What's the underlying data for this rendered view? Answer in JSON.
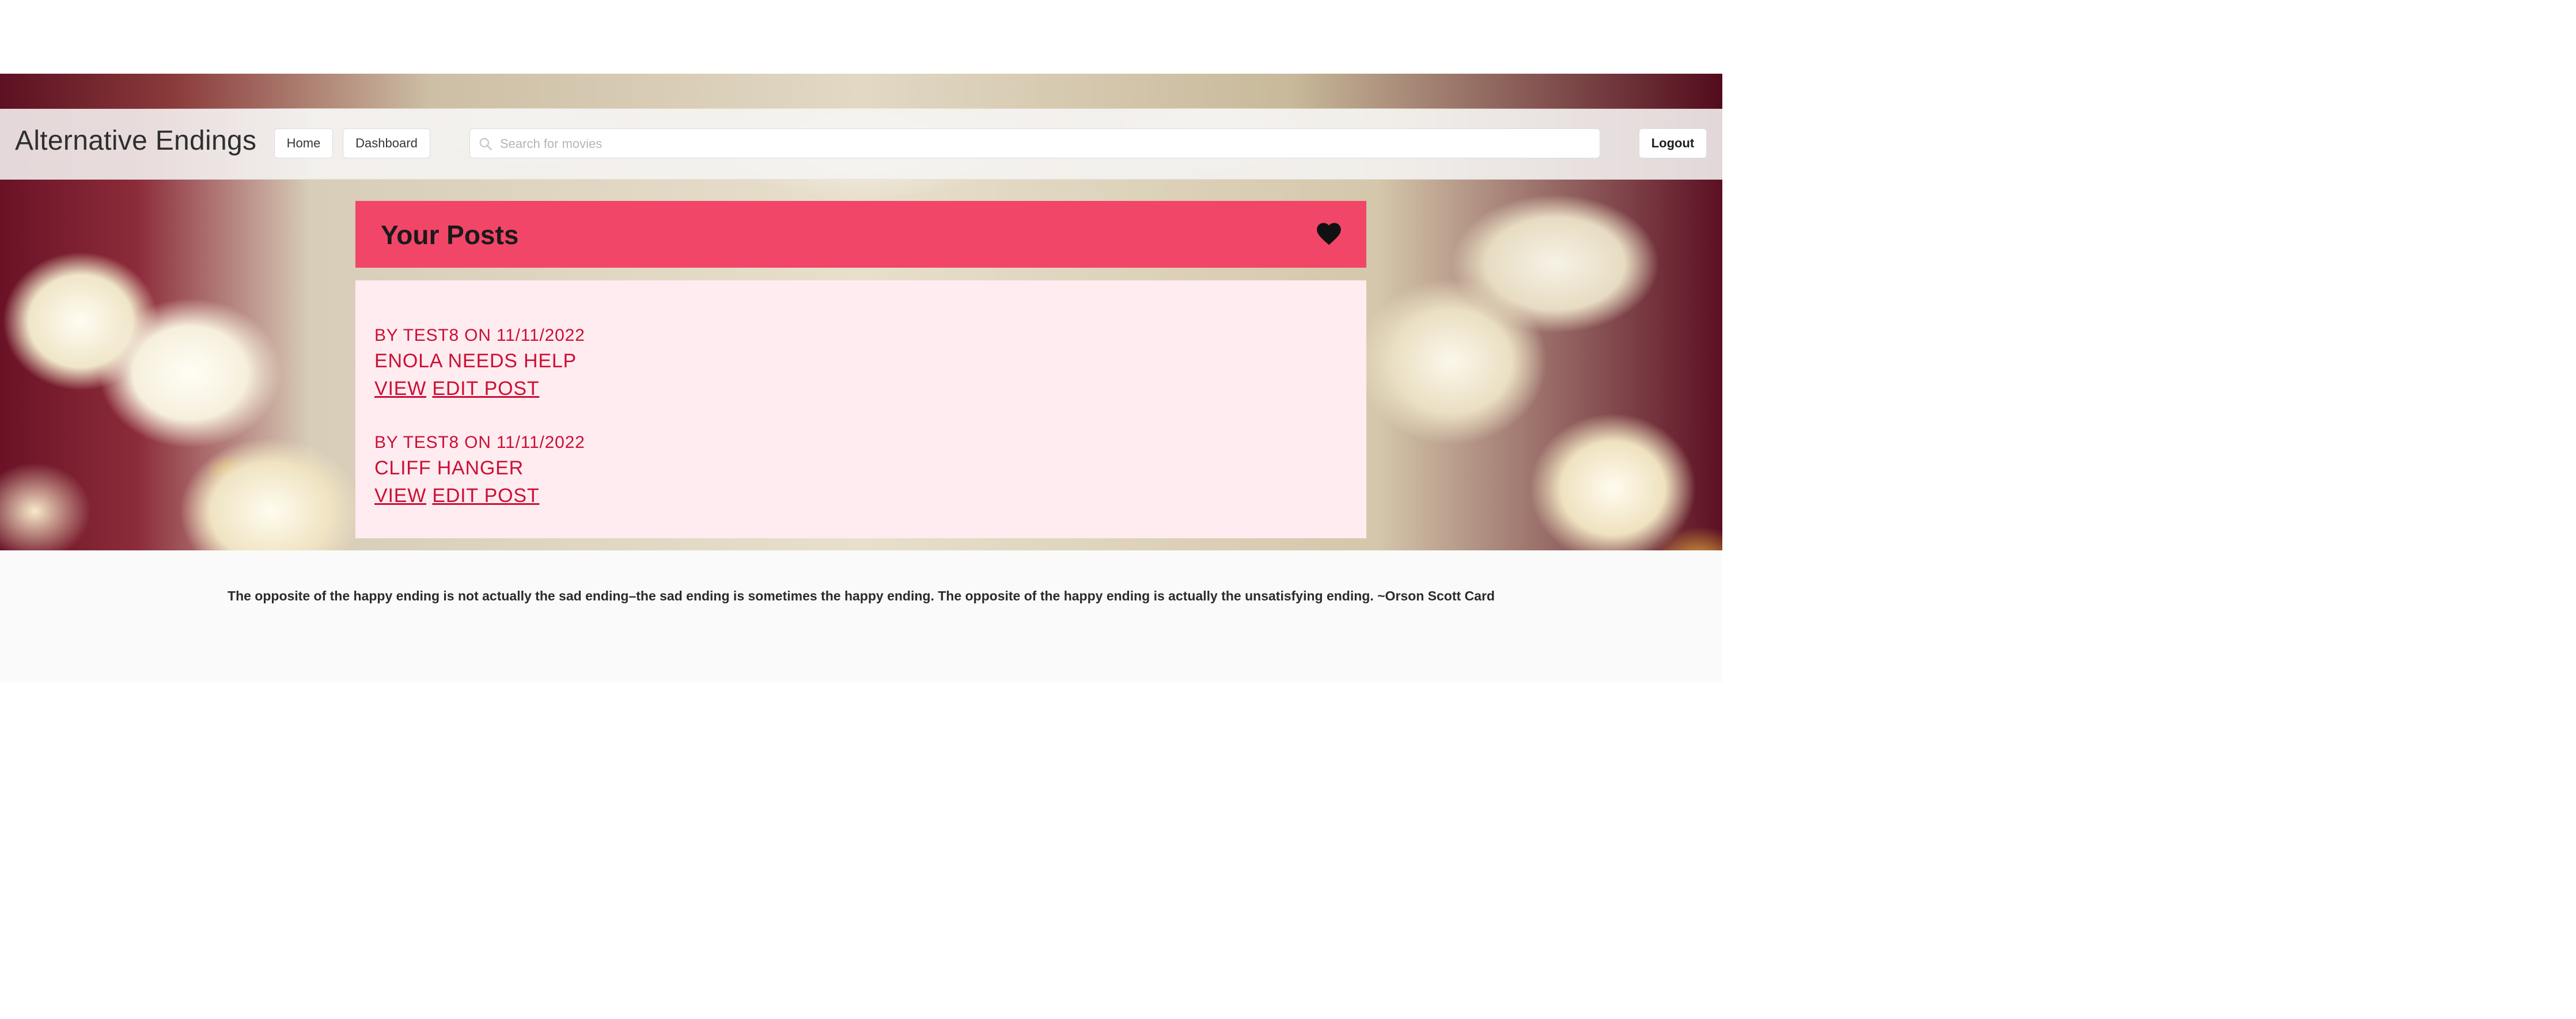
{
  "header": {
    "brand": "Alternative Endings",
    "nav": {
      "home_label": "Home",
      "dashboard_label": "Dashboard",
      "logout_label": "Logout"
    },
    "search": {
      "placeholder": "Search for movies",
      "value": "",
      "icon": "search-icon"
    }
  },
  "posts_panel": {
    "title": "Your Posts",
    "icon": "heart-icon",
    "header_color": "#f14668",
    "body_color": "#feecf0",
    "text_color": "#cc0f35",
    "posts": [
      {
        "meta": "By test8 on 11/11/2022",
        "title": "Enola Needs Help",
        "view_label": "View",
        "edit_label": "Edit Post"
      },
      {
        "meta": "By test8 on 11/11/2022",
        "title": "Cliff Hanger",
        "view_label": "View",
        "edit_label": "Edit Post"
      }
    ]
  },
  "footer": {
    "quote": "The opposite of the happy ending is not actually the sad ending–the sad ending is sometimes the happy ending. The opposite of the happy ending is actually the unsatisfying ending. ~Orson Scott Card"
  }
}
